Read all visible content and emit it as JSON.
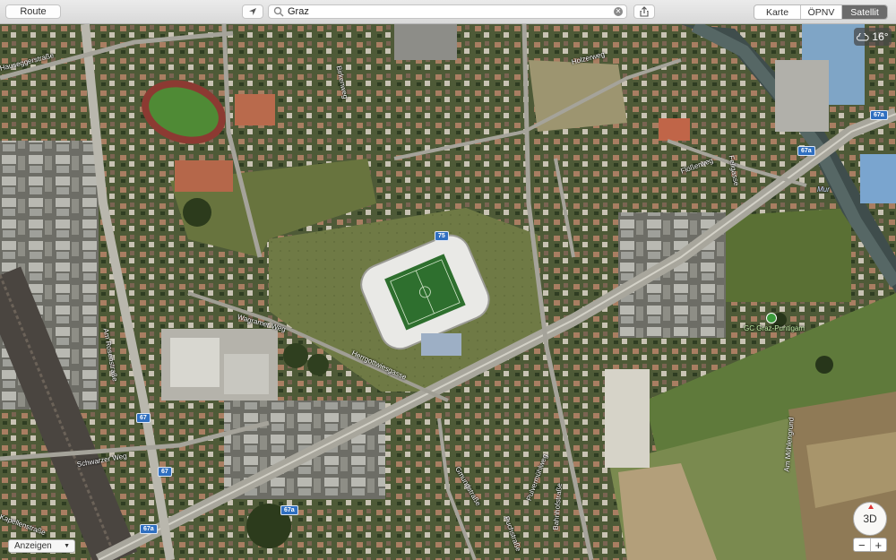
{
  "toolbar": {
    "route_label": "Route",
    "search_value": "Graz",
    "clear_icon": "clear-icon",
    "share_icon": "share-icon",
    "location_icon": "location-arrow-icon",
    "map_modes": [
      "Karte",
      "ÖPNV",
      "Satellit"
    ],
    "active_mode": "Satellit"
  },
  "weather": {
    "temperature": "16°",
    "icon": "cloud-icon"
  },
  "map": {
    "streets": [
      "Hauseggerstraße",
      "Birkenweg",
      "Holzerweg",
      "Flößerweg",
      "Fellgasse",
      "Wagramer Weg",
      "Herrgottwiesgasse",
      "Am Rosenstraße",
      "Schwarzer Weg",
      "Gmundstraße",
      "Pulvermühlweg",
      "Am Mühlengrund",
      "Puchstraße",
      "Bahnhofstraße",
      "Kapellenstraße"
    ],
    "water_label": "Mur",
    "poi_label": "GC Graz-Puntigam",
    "route_shields": [
      "67a",
      "75",
      "67a",
      "67",
      "67",
      "67a",
      "67a"
    ]
  },
  "controls": {
    "display_select": "Anzeigen",
    "compass_label": "3D",
    "zoom_out": "−",
    "zoom_in": "+"
  },
  "colors": {
    "satellite_green": "#5a6b3a",
    "road": "#b8b8b0",
    "active_segment": "#6b6b6b",
    "shield": "#2f6fc0"
  }
}
